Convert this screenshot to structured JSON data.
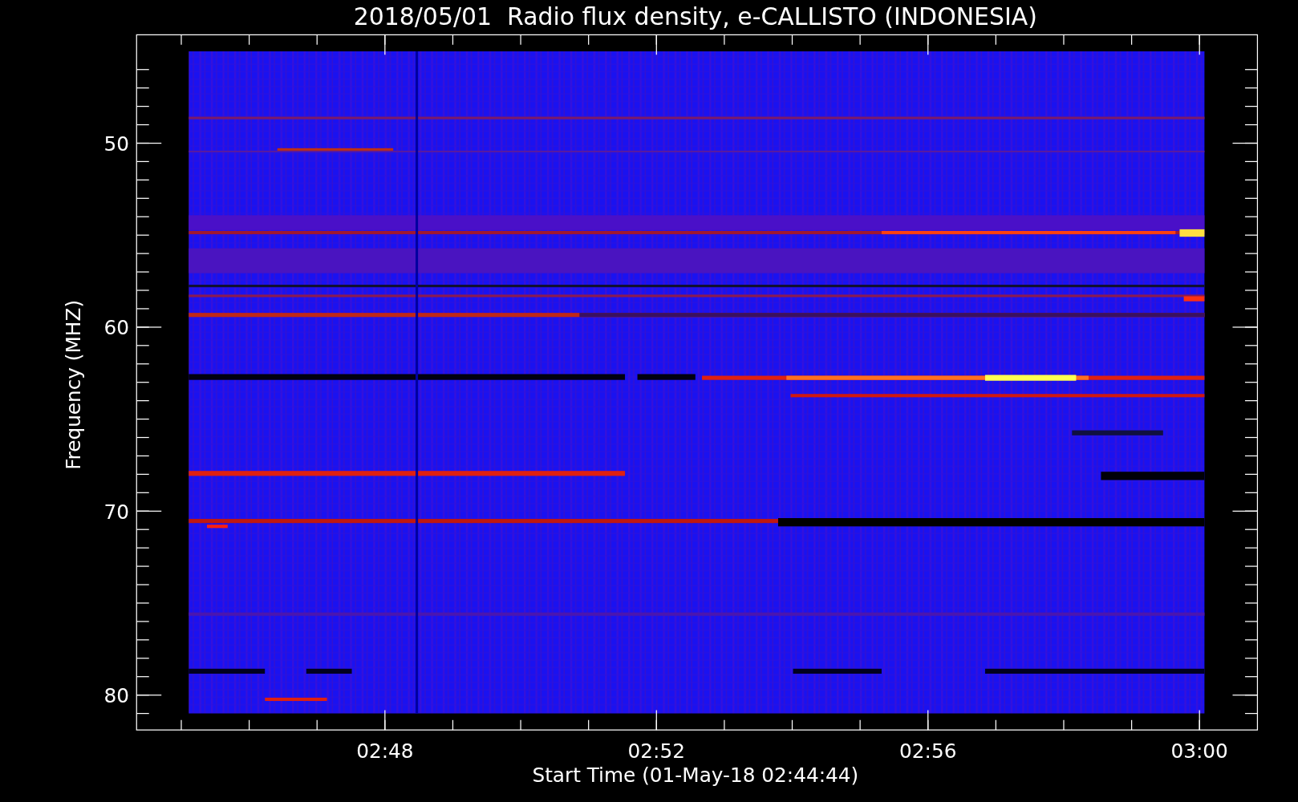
{
  "title": "2018/05/01  Radio flux density, e-CALLISTO (INDONESIA)",
  "y_axis": {
    "label": "Frequency (MHZ)",
    "ticks": [
      "50",
      "60",
      "70",
      "80"
    ]
  },
  "x_axis": {
    "label": "Start Time (01-May-18 02:44:44)",
    "ticks": [
      "02:48",
      "02:52",
      "02:56",
      "03:00"
    ]
  }
}
